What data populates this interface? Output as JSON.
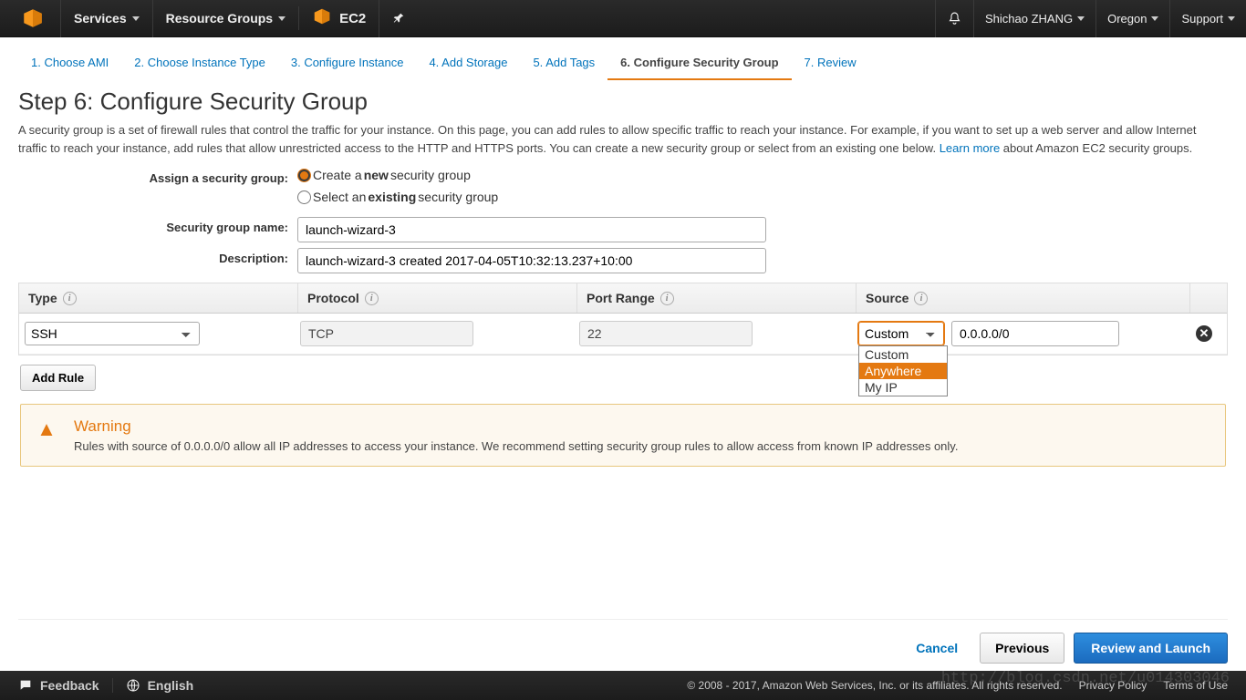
{
  "topnav": {
    "services": "Services",
    "resource_groups": "Resource Groups",
    "ec2": "EC2",
    "user": "Shichao ZHANG",
    "region": "Oregon",
    "support": "Support"
  },
  "steps": [
    "1. Choose AMI",
    "2. Choose Instance Type",
    "3. Configure Instance",
    "4. Add Storage",
    "5. Add Tags",
    "6. Configure Security Group",
    "7. Review"
  ],
  "active_step": 5,
  "page_title": "Step 6: Configure Security Group",
  "page_desc_1": "A security group is a set of firewall rules that control the traffic for your instance. On this page, you can add rules to allow specific traffic to reach your instance. For example, if you want to set up a web server and allow Internet traffic to reach your instance, add rules that allow unrestricted access to the HTTP and HTTPS ports. You can create a new security group or select from an existing one below. ",
  "learn_more": "Learn more",
  "page_desc_2": " about Amazon EC2 security groups.",
  "form": {
    "assign_label": "Assign a security group:",
    "radio_create_pre": "Create a ",
    "radio_create_bold": "new",
    "radio_create_post": " security group",
    "radio_select_pre": "Select an ",
    "radio_select_bold": "existing",
    "radio_select_post": " security group",
    "sg_name_label": "Security group name:",
    "sg_name_value": "launch-wizard-3",
    "desc_label": "Description:",
    "desc_value": "launch-wizard-3 created 2017-04-05T10:32:13.237+10:00"
  },
  "table": {
    "headers": {
      "type": "Type",
      "protocol": "Protocol",
      "port": "Port Range",
      "source": "Source"
    },
    "row": {
      "type": "SSH",
      "protocol": "TCP",
      "port": "22",
      "source_mode": "Custom",
      "source_value": "0.0.0.0/0"
    },
    "source_options": [
      "Custom",
      "Anywhere",
      "My IP"
    ],
    "source_highlight": 1
  },
  "add_rule": "Add Rule",
  "warning": {
    "title": "Warning",
    "text": "Rules with source of 0.0.0.0/0 allow all IP addresses to access your instance. We recommend setting security group rules to allow access from known IP addresses only."
  },
  "buttons": {
    "cancel": "Cancel",
    "previous": "Previous",
    "launch": "Review and Launch"
  },
  "footer": {
    "feedback": "Feedback",
    "language": "English",
    "copyright": "© 2008 - 2017, Amazon Web Services, Inc. or its affiliates. All rights reserved.",
    "privacy": "Privacy Policy",
    "terms": "Terms of Use"
  },
  "watermark": "http://blog.csdn.net/u014303046"
}
